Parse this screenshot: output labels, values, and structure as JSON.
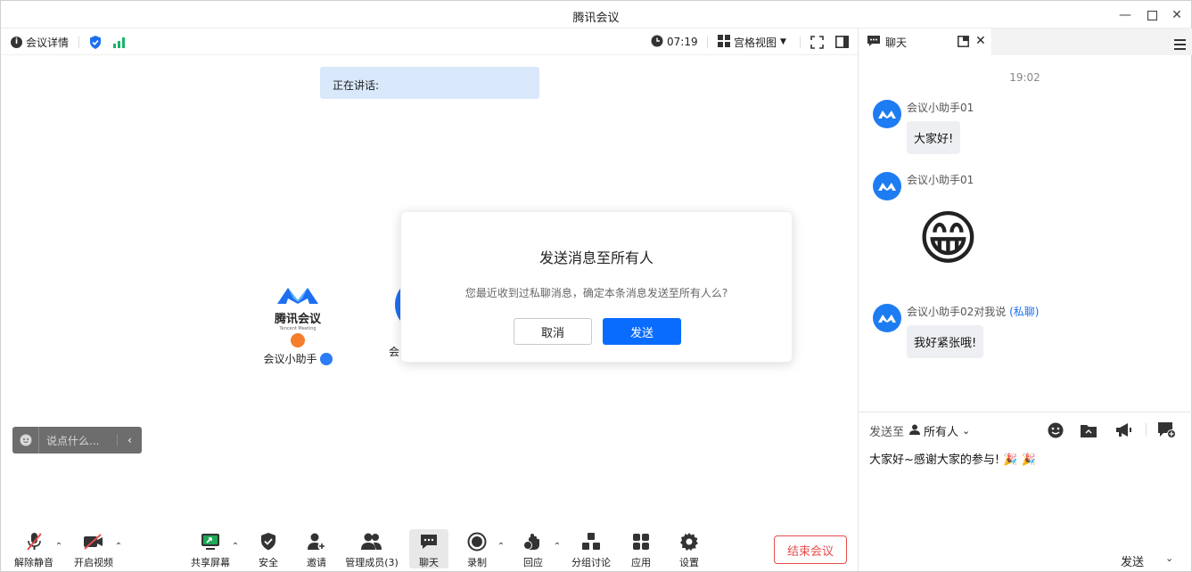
{
  "window": {
    "title": "腾讯会议"
  },
  "topbar": {
    "info_label": "会议详情",
    "time": "07:19",
    "view_label": "宫格视图"
  },
  "stage": {
    "speaking_label": "正在讲话:",
    "participant": {
      "logo_text": "腾讯会议",
      "logo_sub": "Tencent Meeting",
      "name": "会议小助手"
    },
    "partial_name": "会",
    "say_placeholder": "说点什么..."
  },
  "dialog": {
    "title": "发送消息至所有人",
    "message": "您最近收到过私聊消息，确定本条消息发送至所有人么?",
    "cancel": "取消",
    "send": "发送"
  },
  "bottombar": {
    "unmute": "解除静音",
    "video": "开启视频",
    "share": "共享屏幕",
    "security": "安全",
    "invite": "邀请",
    "members": "管理成员(3)",
    "chat": "聊天",
    "record": "录制",
    "react": "回应",
    "breakout": "分组讨论",
    "apps": "应用",
    "settings": "设置",
    "end": "结束会议"
  },
  "chat": {
    "tab_label": "聊天",
    "time": "19:02",
    "messages": [
      {
        "sender": "会议小助手01",
        "text": "大家好!"
      },
      {
        "sender": "会议小助手01",
        "text": "😁"
      },
      {
        "sender": "会议小助手02对我说",
        "private_tag": "(私聊)",
        "text": "我好紧张哦!"
      }
    ],
    "sendto_label": "发送至",
    "sendto_target": "所有人",
    "draft": "大家好~感谢大家的参与! 🎉 🎉",
    "send": "发送"
  },
  "colors": {
    "accent": "#0a6cff",
    "danger": "#e84b4b",
    "signal": "#19b36b"
  }
}
